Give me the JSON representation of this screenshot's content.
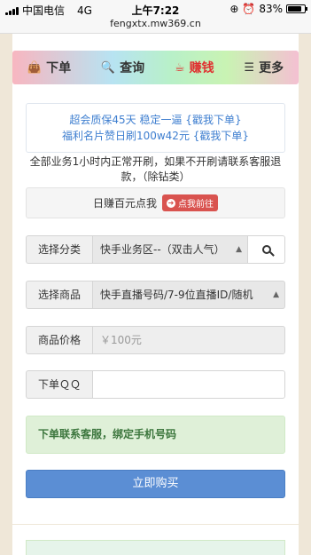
{
  "status_bar": {
    "carrier": "中国电信",
    "network": "4G",
    "time": "上午7:22",
    "battery": "83%",
    "battery_level": 0.83
  },
  "url": "fengxtx.mw369.cn",
  "nav": {
    "items": [
      {
        "icon": "shopping-bag-icon",
        "label": "下单",
        "active": false
      },
      {
        "icon": "search-icon",
        "label": "查询",
        "active": false
      },
      {
        "icon": "coffee-cup-icon",
        "label": "赚钱",
        "active": true
      },
      {
        "icon": "list-icon",
        "label": "更多",
        "active": false
      }
    ],
    "accent_color": "#e0302f"
  },
  "notice": {
    "line1": "超会质保45天 稳定一逼 {戳我下单}",
    "line2": "福利名片赞日刷100w42元 {戳我下单}"
  },
  "info_text": "全部业务1小时内正常开刷，如果不开刷请联系客服退款，（除钻类）",
  "promo": {
    "text": "日赚百元点我",
    "badge": "点我前往"
  },
  "form": {
    "category": {
      "label": "选择分类",
      "value": "快手业务区--（双击人气）"
    },
    "product": {
      "label": "选择商品",
      "value": "快手直播号码/7-9位直播ID/随机"
    },
    "price": {
      "label": "商品价格",
      "value": "￥100元"
    },
    "qq": {
      "label": "下单ＱＱ",
      "value": ""
    }
  },
  "alert_text": "下单联系客服，绑定手机号码",
  "buy_button": "立即购买"
}
